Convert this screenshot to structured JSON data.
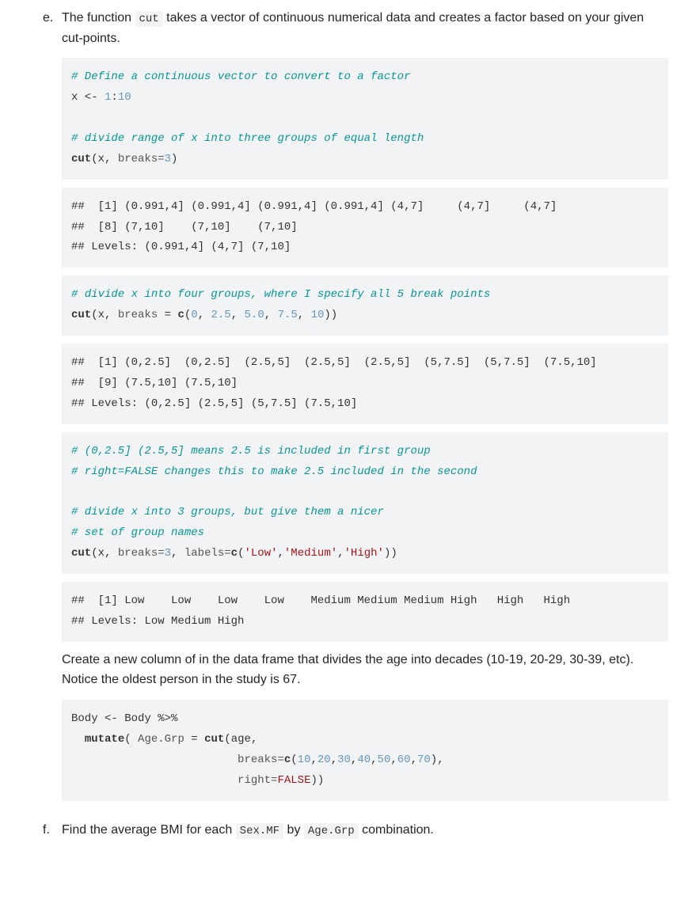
{
  "itemE": {
    "marker": "e.",
    "introPrefix": "The function ",
    "introCode": "cut",
    "introSuffix": " takes a vector of continuous numerical data and creates a factor based on your given cut-points.",
    "code1": {
      "c1": "# Define a continuous vector to convert to a factor",
      "l1a": "x <- ",
      "l1b": "1",
      "l1c": ":",
      "l1d": "10",
      "c2": "# divide range of x into three groups of equal length",
      "l2a": "cut",
      "l2b": "(x, ",
      "l2c": "breaks=",
      "l2d": "3",
      "l2e": ")"
    },
    "out1": "##  [1] (0.991,4] (0.991,4] (0.991,4] (0.991,4] (4,7]     (4,7]     (4,7]    \n##  [8] (7,10]    (7,10]    (7,10]   \n## Levels: (0.991,4] (4,7] (7,10]",
    "code2": {
      "c1": "# divide x into four groups, where I specify all 5 break points",
      "l1a": "cut",
      "l1b": "(x, ",
      "l1c": "breaks",
      "l1d": " = ",
      "l1e": "c",
      "l1f": "(",
      "n1": "0",
      "s1": ", ",
      "n2": "2.5",
      "s2": ", ",
      "n3": "5.0",
      "s3": ", ",
      "n4": "7.5",
      "s4": ", ",
      "n5": "10",
      "l1g": "))"
    },
    "out2": "##  [1] (0,2.5]  (0,2.5]  (2.5,5]  (2.5,5]  (2.5,5]  (5,7.5]  (5,7.5]  (7.5,10]\n##  [9] (7.5,10] (7.5,10]\n## Levels: (0,2.5] (2.5,5] (5,7.5] (7.5,10]",
    "code3": {
      "c1": "# (0,2.5] (2.5,5] means 2.5 is included in first group",
      "c2": "# right=FALSE changes this to make 2.5 included in the second",
      "c3": "# divide x into 3 groups, but give them a nicer",
      "c4": "# set of group names",
      "l1a": "cut",
      "l1b": "(x, ",
      "l1c": "breaks=",
      "l1d": "3",
      "l1e": ", ",
      "l1f": "labels=",
      "l1g": "c",
      "l1h": "(",
      "s1": "'Low'",
      "d1": ",",
      "s2": "'Medium'",
      "d2": ",",
      "s3": "'High'",
      "l1i": "))"
    },
    "out3": "##  [1] Low    Low    Low    Low    Medium Medium Medium High   High   High  \n## Levels: Low Medium High",
    "para2": "Create a new column of in the data frame that divides the age into decades (10-19, 20-29, 30-39, etc). Notice the oldest person in the study is 67.",
    "code4": {
      "l1": "Body <- Body %>%",
      "l2a": "  ",
      "l2b": "mutate",
      "l2c": "( ",
      "l2d": "Age.Grp",
      "l2e": " = ",
      "l2f": "cut",
      "l2g": "(age,",
      "l3a": "                         ",
      "l3b": "breaks=",
      "l3c": "c",
      "l3d": "(",
      "n1": "10",
      "c1": ",",
      "n2": "20",
      "c2": ",",
      "n3": "30",
      "c3": ",",
      "n4": "40",
      "c4": ",",
      "n5": "50",
      "c5": ",",
      "n6": "60",
      "c6": ",",
      "n7": "70",
      "l3e": "),",
      "l4a": "                         ",
      "l4b": "right=",
      "l4c": "FALSE",
      "l4d": "))"
    }
  },
  "itemF": {
    "marker": "f.",
    "t1": "Find the average BMI for each ",
    "code1": "Sex.MF",
    "t2": " by ",
    "code2": "Age.Grp",
    "t3": " combination."
  }
}
